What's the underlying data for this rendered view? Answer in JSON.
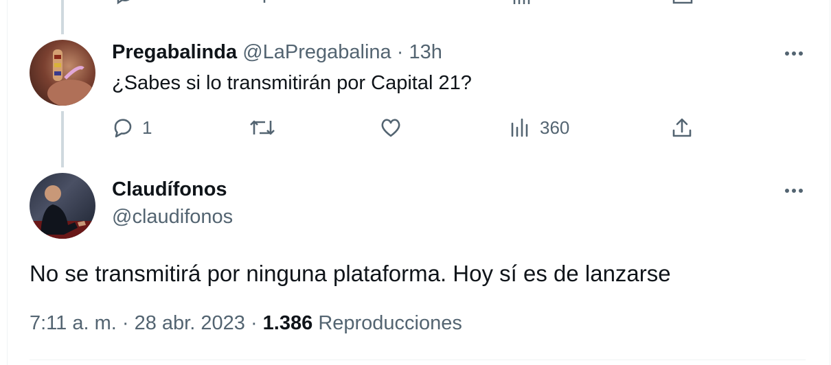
{
  "reply": {
    "display_name": "Pregabalinda",
    "handle": "@LaPregabalina",
    "separator": "·",
    "time": "13h",
    "text": "¿Sabes si lo transmitirán por Capital 21?",
    "actions": {
      "reply_count": "1",
      "retweet_count": "",
      "like_count": "",
      "views_count": "360"
    }
  },
  "main": {
    "display_name": "Claudífonos",
    "handle": "@claudifonos",
    "text": "No se transmitirá por ninguna plataforma. Hoy sí es de lanzarse",
    "time": "7:11 a. m.",
    "separator": "·",
    "date": "28 abr. 2023",
    "views_count": "1.386",
    "views_label": "Reproducciones"
  },
  "icons": {
    "reply": "reply-icon",
    "retweet": "retweet-icon",
    "like": "like-icon",
    "views": "views-icon",
    "share": "share-icon",
    "more": "more-icon"
  },
  "colors": {
    "text": "#0f1419",
    "muted": "#536471",
    "thread_line": "#cfd9de",
    "divider": "#eff3f4"
  }
}
